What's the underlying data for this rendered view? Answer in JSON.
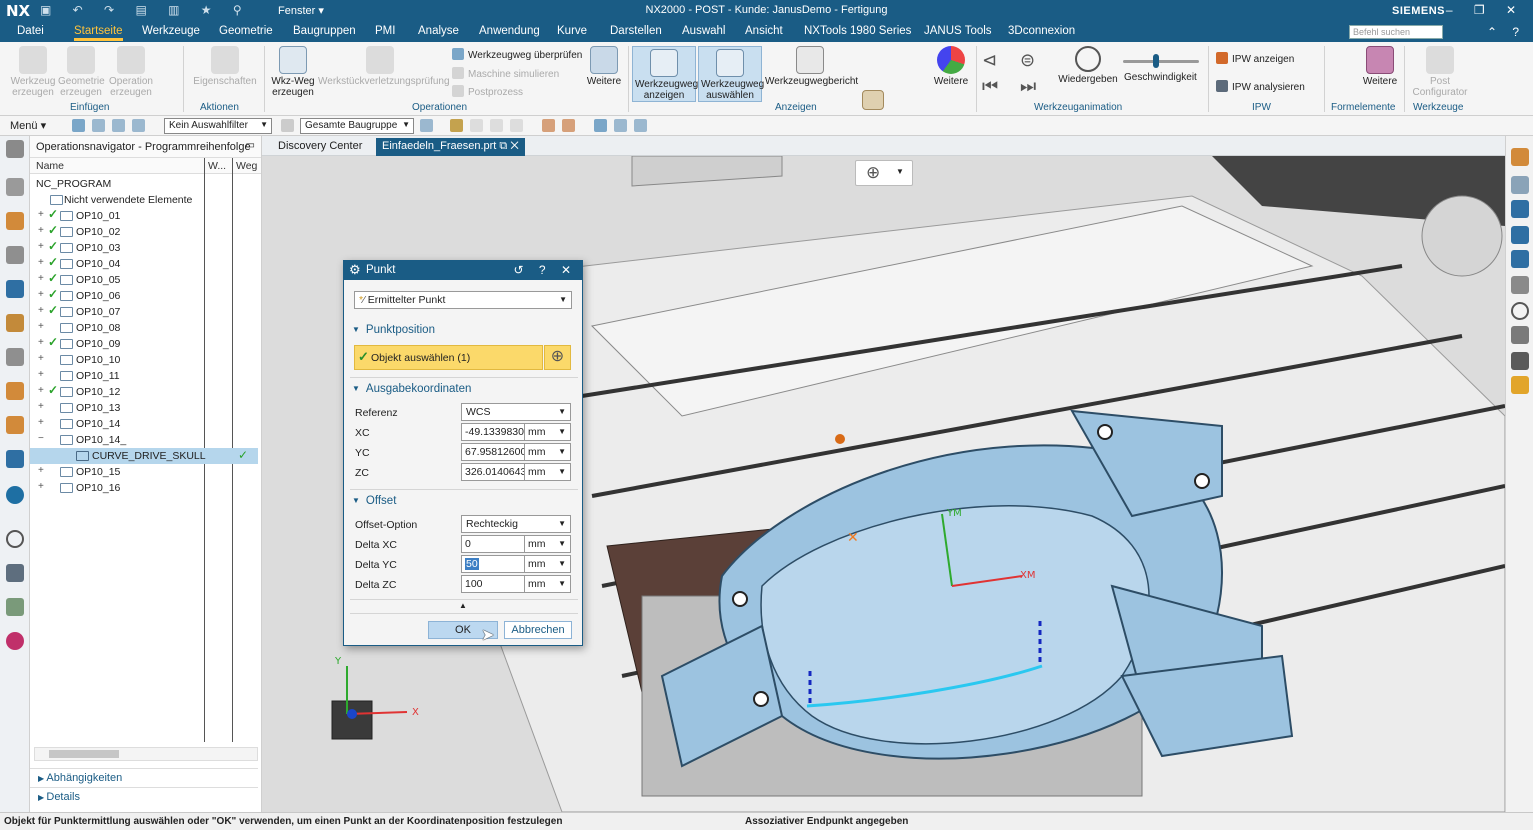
{
  "titlebar": {
    "logo": "NX",
    "window_menu": "Fenster ▾",
    "title": "NX2000 - POST - Kunde: JanusDemo - Fertigung",
    "brand": "SIEMENS",
    "window_controls": "– ❐ ✕"
  },
  "menubar": {
    "tabs": [
      "Datei",
      "Startseite",
      "Werkzeuge",
      "Geometrie",
      "Baugruppen",
      "PMI",
      "Analyse",
      "Anwendung",
      "Kurve",
      "Darstellen",
      "Auswahl",
      "Ansicht",
      "NXTools 1980 Series",
      "JANUS Tools",
      "3Dconnexion"
    ],
    "active_tab": "Startseite",
    "search_placeholder": "Befehl suchen"
  },
  "ribbon": {
    "einfuegen": {
      "group_label": "Einfügen",
      "buttons": [
        "Werkzeug erzeugen",
        "Geometrie erzeugen",
        "Operation erzeugen"
      ]
    },
    "aktionen": {
      "group_label": "Aktionen",
      "eigenschaften": "Eigenschaften"
    },
    "operationen": {
      "group_label": "Operationen",
      "wkz_weg": "Wkz-Weg erzeugen",
      "verletzung": "Werkstückverletzungsprüfung",
      "ueberpruefen": "Werkzeugweg überprüfen",
      "maschine": "Maschine simulieren",
      "postprozess": "Postprozess",
      "weitere": "Weitere"
    },
    "anzeigen": {
      "group_label": "Anzeigen",
      "ww_anzeigen": "Werkzeugweg anzeigen",
      "ww_auswaehlen": "Werkzeugweg auswählen",
      "ww_bericht": "Werkzeugwegbericht",
      "weitere": "Weitere"
    },
    "animation": {
      "group_label": "Werkzeuganimation",
      "wiedergeben": "Wiedergeben",
      "geschwindigkeit": "Geschwindigkeit"
    },
    "ipw": {
      "group_label": "IPW",
      "anzeigen": "IPW anzeigen",
      "analysieren": "IPW analysieren"
    },
    "formelemente": {
      "group_label": "Formelemente",
      "weitere": "Weitere"
    },
    "werkzeuge": {
      "group_label": "Werkzeuge",
      "post_configurator": "Post Configurator"
    }
  },
  "toolbar2": {
    "menu": "Menü ▾",
    "filter": "Kein Auswahlfilter",
    "assembly": "Gesamte Baugruppe"
  },
  "navigator": {
    "title": "Operationsnavigator - Programmreihenfolge",
    "col_name": "Name",
    "col_w": "W...",
    "col_weg": "Weg",
    "root": "NC_PROGRAM",
    "unused": "Nicht verwendete Elemente",
    "ops": [
      "OP10_01",
      "OP10_02",
      "OP10_03",
      "OP10_04",
      "OP10_05",
      "OP10_06",
      "OP10_07",
      "OP10_08",
      "OP10_09",
      "OP10_10",
      "OP10_11",
      "OP10_12",
      "OP10_13",
      "OP10_14",
      "OP10_14_",
      "CURVE_DRIVE_SKULL",
      "OP10_15",
      "OP10_16"
    ],
    "footer_1": "Abhängigkeiten",
    "footer_2": "Details"
  },
  "doc_tabs": {
    "tab1": "Discovery Center",
    "tab2": "Einfaedeln_Fraesen.prt"
  },
  "dialog": {
    "title": "Punkt",
    "type": "Ermittelter Punkt",
    "sec_position": "Punktposition",
    "select_object": "Objekt auswählen (1)",
    "sec_output": "Ausgabekoordinaten",
    "referenz_label": "Referenz",
    "referenz_value": "WCS",
    "xc_label": "XC",
    "xc_value": "-49.13398303!",
    "yc_label": "YC",
    "yc_value": "67.95812600!",
    "zc_label": "ZC",
    "zc_value": "326.01406435!",
    "unit": "mm",
    "sec_offset": "Offset",
    "offset_option_label": "Offset-Option",
    "offset_option_value": "Rechteckig",
    "dxc_label": "Delta XC",
    "dxc_value": "0",
    "dyc_label": "Delta YC",
    "dyc_value": "50",
    "dzc_label": "Delta ZC",
    "dzc_value": "100",
    "ok": "OK",
    "cancel": "Abbrechen"
  },
  "viewport": {
    "axis_labels": {
      "x": "X",
      "y": "Y",
      "xm": "XM",
      "ym": "YM"
    }
  },
  "status": {
    "left": "Objekt für Punktermittlung auswählen oder \"OK\" verwenden, um einen Punkt an der Koordinatenposition festzulegen",
    "right": "Assoziativer Endpunkt angegeben"
  },
  "colors": {
    "accent": "#1a5c85",
    "highlight": "#fbd96a",
    "check": "#2aa22a",
    "part": "#9cc3e0"
  }
}
